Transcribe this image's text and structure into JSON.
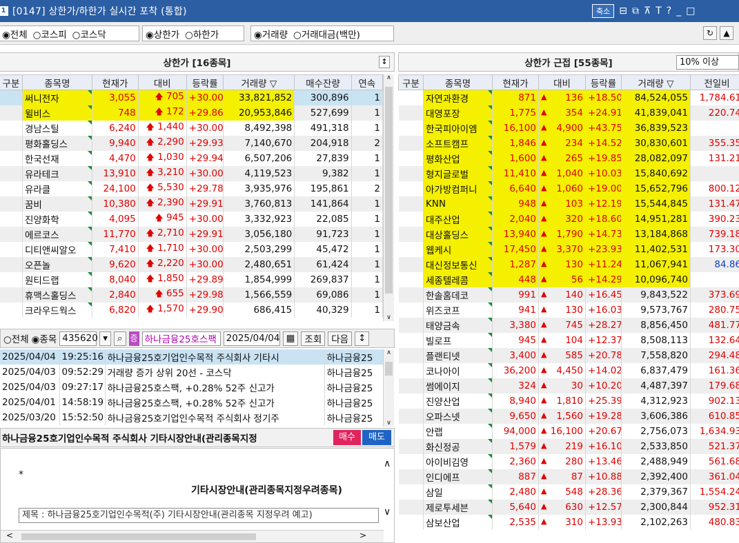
{
  "window": {
    "num": "1",
    "title": "[0147] 상한가/하한가 실시간 포착 (통합)",
    "shrink_label": "축소",
    "icons": [
      "window-tile-icon",
      "window-cascade-icon",
      "pin-icon",
      "font-icon",
      "help-icon",
      "minimize-icon",
      "maximize-icon"
    ]
  },
  "toolbar": {
    "market_options": [
      "전체",
      "코스피",
      "코스닥"
    ],
    "market_selected": "전체",
    "limit_options": [
      "상한가",
      "하한가"
    ],
    "limit_selected": "상한가",
    "sort_options": [
      "거래량",
      "거래대금(백만)"
    ],
    "sort_selected": "거래량"
  },
  "left_panel": {
    "title": "상한가 [16종목]",
    "columns": [
      "구분",
      "종목명",
      "현재가",
      "대비",
      "등락률",
      "거래량 ▽",
      "매수잔량",
      "연속"
    ],
    "rows": [
      {
        "name": "써니전자",
        "price": "3,055",
        "diff": "705",
        "rate": "+30.00",
        "vol": "33,821,852",
        "bid": "300,896",
        "cont": "1",
        "hl": true
      },
      {
        "name": "윌비스",
        "price": "748",
        "diff": "172",
        "rate": "+29.86",
        "vol": "20,953,846",
        "bid": "527,699",
        "cont": "1",
        "hl": true
      },
      {
        "name": "경남스틸",
        "price": "6,240",
        "diff": "1,440",
        "rate": "+30.00",
        "vol": "8,492,398",
        "bid": "491,318",
        "cont": "1"
      },
      {
        "name": "평화홀딩스",
        "price": "9,940",
        "diff": "2,290",
        "rate": "+29.93",
        "vol": "7,140,670",
        "bid": "204,918",
        "cont": "2"
      },
      {
        "name": "한국선재",
        "price": "4,470",
        "diff": "1,030",
        "rate": "+29.94",
        "vol": "6,507,206",
        "bid": "27,839",
        "cont": "1"
      },
      {
        "name": "유라테크",
        "price": "13,910",
        "diff": "3,210",
        "rate": "+30.00",
        "vol": "4,119,523",
        "bid": "9,382",
        "cont": "1"
      },
      {
        "name": "유라클",
        "price": "24,100",
        "diff": "5,530",
        "rate": "+29.78",
        "vol": "3,935,976",
        "bid": "195,861",
        "cont": "2"
      },
      {
        "name": "꿈비",
        "price": "10,380",
        "diff": "2,390",
        "rate": "+29.91",
        "vol": "3,760,813",
        "bid": "141,864",
        "cont": "1"
      },
      {
        "name": "진양화학",
        "price": "4,095",
        "diff": "945",
        "rate": "+30.00",
        "vol": "3,332,923",
        "bid": "22,085",
        "cont": "1"
      },
      {
        "name": "에르코스",
        "price": "11,770",
        "diff": "2,710",
        "rate": "+29.91",
        "vol": "3,056,180",
        "bid": "91,723",
        "cont": "1"
      },
      {
        "name": "디티앤씨알오",
        "price": "7,410",
        "diff": "1,710",
        "rate": "+30.00",
        "vol": "2,503,299",
        "bid": "45,472",
        "cont": "1"
      },
      {
        "name": "오픈놀",
        "price": "9,620",
        "diff": "2,220",
        "rate": "+30.00",
        "vol": "2,480,651",
        "bid": "61,424",
        "cont": "1"
      },
      {
        "name": "원티드랩",
        "price": "8,040",
        "diff": "1,850",
        "rate": "+29.89",
        "vol": "1,854,999",
        "bid": "269,837",
        "cont": "1"
      },
      {
        "name": "휴맥스홀딩스",
        "price": "2,840",
        "diff": "655",
        "rate": "+29.98",
        "vol": "1,566,559",
        "bid": "69,086",
        "cont": "1"
      },
      {
        "name": "크라우드웍스",
        "price": "6,820",
        "diff": "1,570",
        "rate": "+29.90",
        "vol": "686,415",
        "bid": "40,329",
        "cont": "1"
      }
    ]
  },
  "right_panel": {
    "title": "상한가 근접 [55종목]",
    "filter": "10% 이상",
    "columns": [
      "구분",
      "종목명",
      "현재가",
      "대비",
      "등락률",
      "거래량 ▽",
      "전일비"
    ],
    "rows": [
      {
        "name": "자연과환경",
        "price": "871",
        "diff": "136",
        "rate": "+18.50",
        "vol": "84,524,055",
        "prev": "1,784.61",
        "hl": true
      },
      {
        "name": "대영포장",
        "price": "1,775",
        "diff": "354",
        "rate": "+24.91",
        "vol": "41,839,041",
        "prev": "220.74",
        "hl": true
      },
      {
        "name": "한국피아이엠",
        "price": "16,100",
        "diff": "4,900",
        "rate": "+43.75",
        "vol": "36,839,523",
        "prev": "",
        "hl": true
      },
      {
        "name": "소프트캠프",
        "price": "1,846",
        "diff": "234",
        "rate": "+14.52",
        "vol": "30,830,601",
        "prev": "355.35",
        "hl": true
      },
      {
        "name": "평화산업",
        "price": "1,600",
        "diff": "265",
        "rate": "+19.85",
        "vol": "28,082,097",
        "prev": "131.21",
        "hl": true
      },
      {
        "name": "형지글로벌",
        "price": "11,410",
        "diff": "1,040",
        "rate": "+10.03",
        "vol": "15,840,692",
        "prev": "",
        "hl": true
      },
      {
        "name": "아가방컴퍼니",
        "price": "6,640",
        "diff": "1,060",
        "rate": "+19.00",
        "vol": "15,652,796",
        "prev": "800.12",
        "hl": true
      },
      {
        "name": "KNN",
        "price": "948",
        "diff": "103",
        "rate": "+12.19",
        "vol": "15,544,845",
        "prev": "131.47",
        "hl": true
      },
      {
        "name": "대주산업",
        "price": "2,040",
        "diff": "320",
        "rate": "+18.60",
        "vol": "14,951,281",
        "prev": "390.23",
        "hl": true
      },
      {
        "name": "대상홀딩스",
        "price": "13,940",
        "diff": "1,790",
        "rate": "+14.73",
        "vol": "13,184,868",
        "prev": "739.18",
        "hl": true
      },
      {
        "name": "웹케시",
        "price": "17,450",
        "diff": "3,370",
        "rate": "+23.93",
        "vol": "11,402,531",
        "prev": "173.30",
        "hl": true
      },
      {
        "name": "대신정보통신",
        "price": "1,287",
        "diff": "130",
        "rate": "+11.24",
        "vol": "11,067,941",
        "prev": "84.86",
        "hl": true,
        "prevblue": true
      },
      {
        "name": "세종텔레콤",
        "price": "448",
        "diff": "56",
        "rate": "+14.29",
        "vol": "10,096,740",
        "prev": "",
        "hl": true
      },
      {
        "name": "한솔홈데코",
        "price": "991",
        "diff": "140",
        "rate": "+16.45",
        "vol": "9,843,522",
        "prev": "373.69"
      },
      {
        "name": "위즈코프",
        "price": "941",
        "diff": "130",
        "rate": "+16.03",
        "vol": "9,573,767",
        "prev": "280.75"
      },
      {
        "name": "태양금속",
        "price": "3,380",
        "diff": "745",
        "rate": "+28.27",
        "vol": "8,856,450",
        "prev": "481.77"
      },
      {
        "name": "빌로프",
        "price": "945",
        "diff": "104",
        "rate": "+12.37",
        "vol": "8,508,113",
        "prev": "132.64"
      },
      {
        "name": "플랜티넷",
        "price": "3,400",
        "diff": "585",
        "rate": "+20.78",
        "vol": "7,558,820",
        "prev": "294.48"
      },
      {
        "name": "코나아이",
        "price": "36,200",
        "diff": "4,450",
        "rate": "+14.02",
        "vol": "6,837,479",
        "prev": "161.36"
      },
      {
        "name": "썸에이지",
        "price": "324",
        "diff": "30",
        "rate": "+10.20",
        "vol": "4,487,397",
        "prev": "179.68"
      },
      {
        "name": "진양산업",
        "price": "8,940",
        "diff": "1,810",
        "rate": "+25.39",
        "vol": "4,312,923",
        "prev": "902.13"
      },
      {
        "name": "오파스넷",
        "price": "9,650",
        "diff": "1,560",
        "rate": "+19.28",
        "vol": "3,606,386",
        "prev": "610.85"
      },
      {
        "name": "안랩",
        "price": "94,000",
        "diff": "16,100",
        "rate": "+20.67",
        "vol": "2,756,073",
        "prev": "1,634.93"
      },
      {
        "name": "화신정공",
        "price": "1,579",
        "diff": "219",
        "rate": "+16.10",
        "vol": "2,533,850",
        "prev": "521.37"
      },
      {
        "name": "아이비김영",
        "price": "2,360",
        "diff": "280",
        "rate": "+13.46",
        "vol": "2,488,949",
        "prev": "561.68"
      },
      {
        "name": "인디에프",
        "price": "887",
        "diff": "87",
        "rate": "+10.88",
        "vol": "2,392,400",
        "prev": "361.04"
      },
      {
        "name": "삼일",
        "price": "2,480",
        "diff": "548",
        "rate": "+28.36",
        "vol": "2,379,367",
        "prev": "1,554.24"
      },
      {
        "name": "제로투세븐",
        "price": "5,640",
        "diff": "630",
        "rate": "+12.57",
        "vol": "2,300,844",
        "prev": "952.31"
      },
      {
        "name": "삼보산업",
        "price": "2,535",
        "diff": "310",
        "rate": "+13.93",
        "vol": "2,102,263",
        "prev": "480.83"
      }
    ]
  },
  "news_search": {
    "scope_options": [
      "전체",
      "종목"
    ],
    "scope_selected": "종목",
    "code": "435620",
    "stock_name": "하나금융25호스팩",
    "date": "2025/04/04",
    "query_label": "조회",
    "next_label": "다음"
  },
  "news": [
    {
      "date": "2025/04/04",
      "time": "19:25:16",
      "title": "하나금융25호기업인수목적 주식회사 기타시",
      "src": "하나금융25"
    },
    {
      "date": "2025/04/03",
      "time": "09:52:29",
      "title": "거래량 증가 상위 20선 - 코스닥",
      "src": "하나금융25"
    },
    {
      "date": "2025/04/03",
      "time": "09:27:17",
      "title": "하나금융25호스팩, +0.28% 52주 신고가",
      "src": "하나금융25"
    },
    {
      "date": "2025/04/01",
      "time": "14:58:19",
      "title": "하나금융25호스팩, +0.28% 52주 신고가",
      "src": "하나금융25"
    },
    {
      "date": "2025/03/20",
      "time": "15:52:50",
      "title": "하나금융25호기업인수목적 주식회사 정기주",
      "src": "하나금융25"
    }
  ],
  "detail": {
    "headline": "하나금융25호기업인수목적 주식회사 기타시장안내(관리종목지정",
    "buy_label": "매수",
    "sell_label": "매도",
    "bullet": "*",
    "body_title": "기타시장안내(관리종목지정우려종목)",
    "subject": "제목 : 하나금융25호기업인수목적(주) 기타시장안내(관리종목 지정우려 예고)"
  },
  "colors": {
    "titlebar": "#2b5ea3",
    "up": "#e00000",
    "highlight": "#f4f000",
    "selected": "#c9e3f3",
    "buy": "#e0245e",
    "sell": "#1f63c4"
  }
}
